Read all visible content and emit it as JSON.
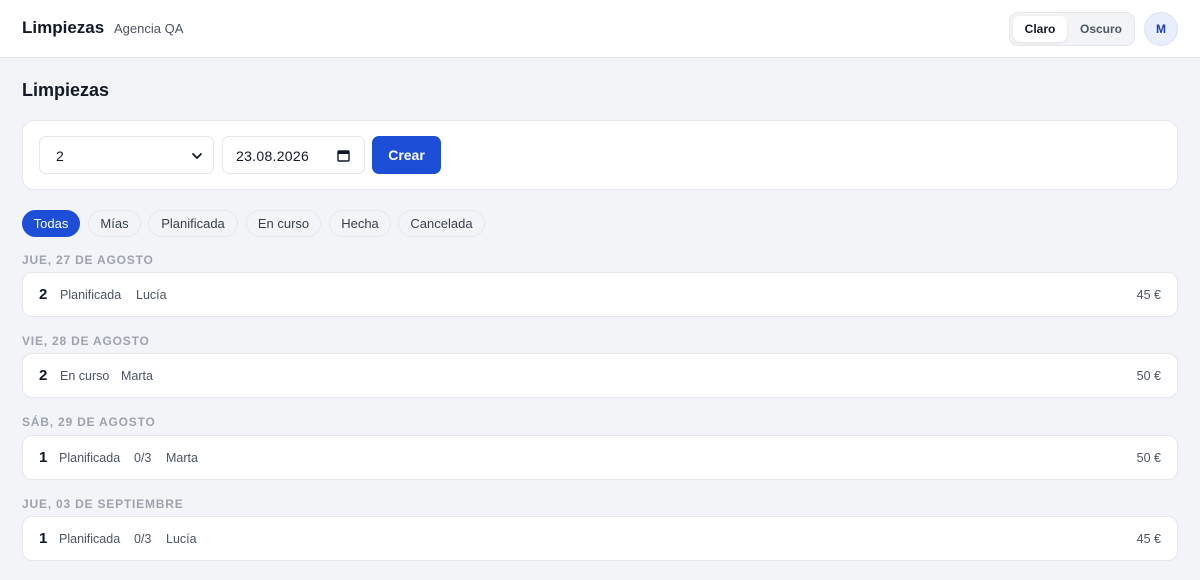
{
  "header": {
    "brand": "Limpiezas",
    "agency": "Agencia QA",
    "theme_light": "Claro",
    "theme_dark": "Oscuro",
    "avatar": "M"
  },
  "page": {
    "title": "Limpiezas"
  },
  "form": {
    "select_value": "2",
    "date_value": "23.08.2026",
    "create_label": "Crear"
  },
  "filters": [
    "Todas",
    "Mías",
    "Planificada",
    "En curso",
    "Hecha",
    "Cancelada"
  ],
  "active_filter": "Todas",
  "groups": [
    {
      "date": "JUE, 27 DE AGOSTO",
      "rows": [
        {
          "num": "2",
          "status": "Planificada",
          "progress": "",
          "person": "Lucía",
          "price": "45 €"
        }
      ]
    },
    {
      "date": "VIE, 28 DE AGOSTO",
      "rows": [
        {
          "num": "2",
          "status": "En curso",
          "progress": "",
          "person": "Marta",
          "price": "50 €"
        }
      ]
    },
    {
      "date": "SÁB, 29 DE AGOSTO",
      "rows": [
        {
          "num": "1",
          "status": "Planificada",
          "progress": "0/3",
          "person": "Marta",
          "price": "50 €"
        }
      ]
    },
    {
      "date": "JUE, 03 DE SEPTIEMBRE",
      "rows": [
        {
          "num": "1",
          "status": "Planificada",
          "progress": "0/3",
          "person": "Lucía",
          "price": "45 €"
        }
      ]
    }
  ],
  "colors": {
    "accent": "#1d4ed8",
    "background": "#f3f4f7",
    "muted": "#9ca3af"
  }
}
